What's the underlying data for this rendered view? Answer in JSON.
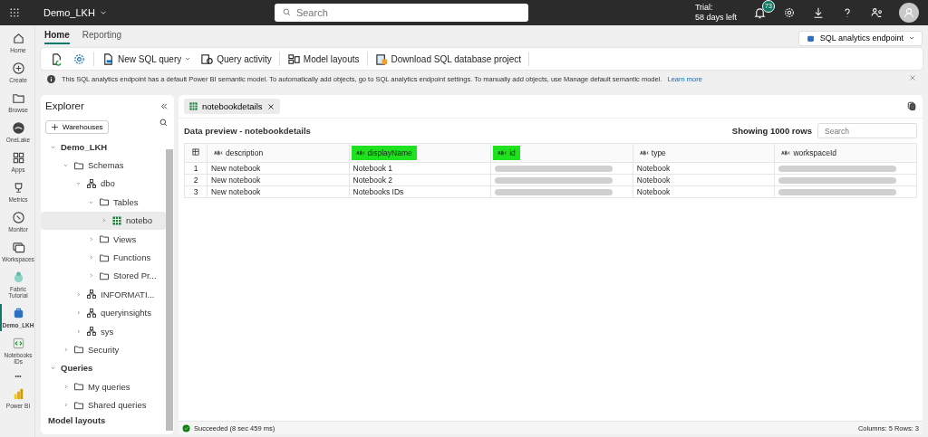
{
  "top_bar": {
    "workspace": "Demo_LKH",
    "search": {
      "placeholder": "Search"
    },
    "trial": [
      "Trial:",
      "58 days left"
    ],
    "notifications": "73"
  },
  "rail": [
    {
      "label": "Home",
      "selected": false
    },
    {
      "label": "Create",
      "selected": false
    },
    {
      "label": "Browse",
      "selected": false
    },
    {
      "label": "OneLake",
      "selected": false
    },
    {
      "label": "Apps",
      "selected": false
    },
    {
      "label": "Metrics",
      "selected": false
    },
    {
      "label": "Monitor",
      "selected": false
    },
    {
      "label": "Workspaces",
      "selected": false
    },
    {
      "label": "Fabric Tutorial",
      "selected": false
    },
    {
      "label": "Demo_LKH",
      "selected": true
    },
    {
      "label": "Notebooks IDs",
      "selected": false
    },
    {
      "label": "•••",
      "selected": false
    },
    {
      "label": "Power BI",
      "selected": false
    }
  ],
  "tabs": [
    {
      "label": "Home",
      "selected": true
    },
    {
      "label": "Reporting",
      "selected": false
    }
  ],
  "mode_dropdown": "SQL analytics endpoint",
  "toolbar": [
    {
      "kind": "icon"
    },
    {
      "kind": "icon"
    },
    {
      "kind": "menu",
      "label": "New SQL query"
    },
    {
      "kind": "button",
      "label": "Query activity"
    },
    {
      "kind": "button",
      "label": "Model layouts"
    },
    {
      "kind": "button",
      "label": "Download SQL database project"
    }
  ],
  "info_bar": {
    "message": "This SQL analytics endpoint has a default Power BI semantic model. To automatically add objects, go to SQL analytics endpoint settings. To manually add objects, use Manage default semantic model.",
    "link": "Learn more"
  },
  "explorer": {
    "title": "Explorer",
    "add_button": "Warehouses",
    "tree": [
      {
        "label": "Demo_LKH",
        "kind": "section",
        "expanded": true,
        "selected": false,
        "children": [
          {
            "label": "Schemas",
            "kind": "folder",
            "expanded": true,
            "selected": false,
            "children": [
              {
                "label": "dbo",
                "kind": "schema",
                "expanded": true,
                "selected": false,
                "children": [
                  {
                    "label": "Tables",
                    "kind": "folder",
                    "expanded": true,
                    "selected": false,
                    "children": [
                      {
                        "label": "notebo",
                        "kind": "table",
                        "expanded": false,
                        "selected": true
                      }
                    ]
                  },
                  {
                    "label": "Views",
                    "kind": "folder",
                    "expanded": false,
                    "selected": false
                  },
                  {
                    "label": "Functions",
                    "kind": "folder",
                    "expanded": false,
                    "selected": false
                  },
                  {
                    "label": "Stored Pr...",
                    "kind": "folder",
                    "expanded": false,
                    "selected": false
                  }
                ]
              },
              {
                "label": "INFORMATI...",
                "kind": "schema",
                "expanded": false,
                "selected": false
              },
              {
                "label": "queryinsights",
                "kind": "schema",
                "expanded": false,
                "selected": false
              },
              {
                "label": "sys",
                "kind": "schema",
                "expanded": false,
                "selected": false
              }
            ]
          },
          {
            "label": "Security",
            "kind": "folder",
            "expanded": false,
            "selected": false
          }
        ]
      },
      {
        "label": "Queries",
        "kind": "section",
        "expanded": true,
        "selected": false,
        "children": [
          {
            "label": "My queries",
            "kind": "folder",
            "expanded": false,
            "selected": false
          },
          {
            "label": "Shared queries",
            "kind": "folder",
            "expanded": false,
            "selected": false
          }
        ]
      },
      {
        "label": "Model layouts",
        "kind": "heading",
        "selected": false
      }
    ]
  },
  "doc_tab": "notebookdetails",
  "preview": {
    "title": "Data preview - notebookdetails",
    "row_count": "Showing 1000 rows",
    "search": {
      "placeholder": "Search"
    },
    "columns": [
      {
        "label": "description",
        "highlighted": false
      },
      {
        "label": "displayName",
        "highlighted": true
      },
      {
        "label": "id",
        "highlighted": true
      },
      {
        "label": "type",
        "highlighted": false
      },
      {
        "label": "workspaceId",
        "highlighted": false
      }
    ],
    "rows": [
      {
        "number": "1",
        "cells": [
          "New notebook",
          "Notebook 1",
          {
            "kind": "redacted"
          },
          "Notebook",
          {
            "kind": "redacted"
          }
        ]
      },
      {
        "number": "2",
        "cells": [
          "New notebook",
          "Notebook 2",
          {
            "kind": "redacted"
          },
          "Notebook",
          {
            "kind": "redacted"
          }
        ]
      },
      {
        "number": "3",
        "cells": [
          "New notebook",
          "Notebooks IDs",
          {
            "kind": "redacted"
          },
          "Notebook",
          {
            "kind": "redacted"
          }
        ]
      }
    ]
  },
  "status_bar": {
    "status": "Succeeded (8 sec 459 ms)",
    "summary": "Columns: 5 Rows: 3"
  }
}
